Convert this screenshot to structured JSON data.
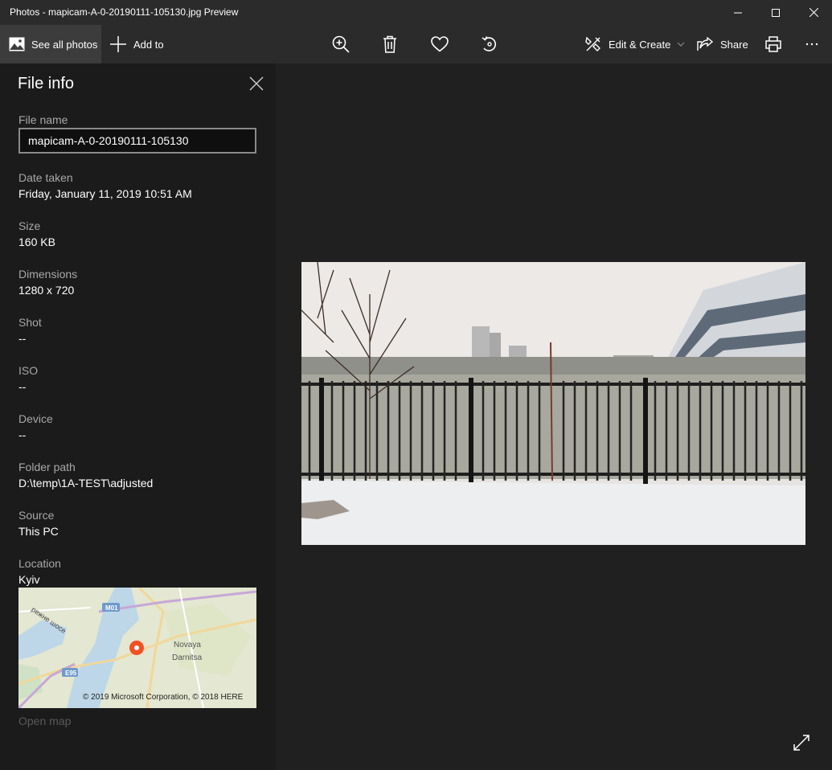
{
  "window": {
    "title": "Photos - mapicam-A-0-20190111-105130.jpg Preview"
  },
  "toolbar": {
    "see_all_label": "See all photos",
    "add_to_label": "Add to",
    "edit_create_label": "Edit & Create",
    "share_label": "Share",
    "icons": [
      "gallery-icon",
      "plus-icon",
      "zoom-in-icon",
      "delete-icon",
      "heart-icon",
      "rotate-icon",
      "edit-create-icon",
      "chevron-down-icon",
      "share-icon",
      "print-icon",
      "more-icon"
    ]
  },
  "file_info": {
    "heading": "File info",
    "file_name_label": "File name",
    "file_name_value": "mapicam-A-0-20190111-105130",
    "date_taken_label": "Date taken",
    "date_taken_value": "Friday, January 11, 2019 10:51 AM",
    "size_label": "Size",
    "size_value": "160 KB",
    "dimensions_label": "Dimensions",
    "dimensions_value": "1280 x 720",
    "shot_label": "Shot",
    "shot_value": "--",
    "iso_label": "ISO",
    "iso_value": "--",
    "device_label": "Device",
    "device_value": "--",
    "folder_label": "Folder path",
    "folder_value": "D:\\temp\\1A-TEST\\adjusted",
    "source_label": "Source",
    "source_value": "This PC",
    "location_label": "Location",
    "location_value": "Kyiv",
    "open_map": "Open map"
  },
  "map": {
    "road_label_m01": "M01",
    "road_label_e95": "E95",
    "place_line1": "Novaya",
    "place_line2": "Darnitsa",
    "road_name": "режне шосе",
    "copyright": "© 2019 Microsoft Corporation, © 2018 HERE",
    "pin_color": "#f25022"
  },
  "colors": {
    "background": "#202020",
    "panel": "#1b1b1b",
    "chrome": "#2b2b2b",
    "label": "#a8a8a8"
  }
}
